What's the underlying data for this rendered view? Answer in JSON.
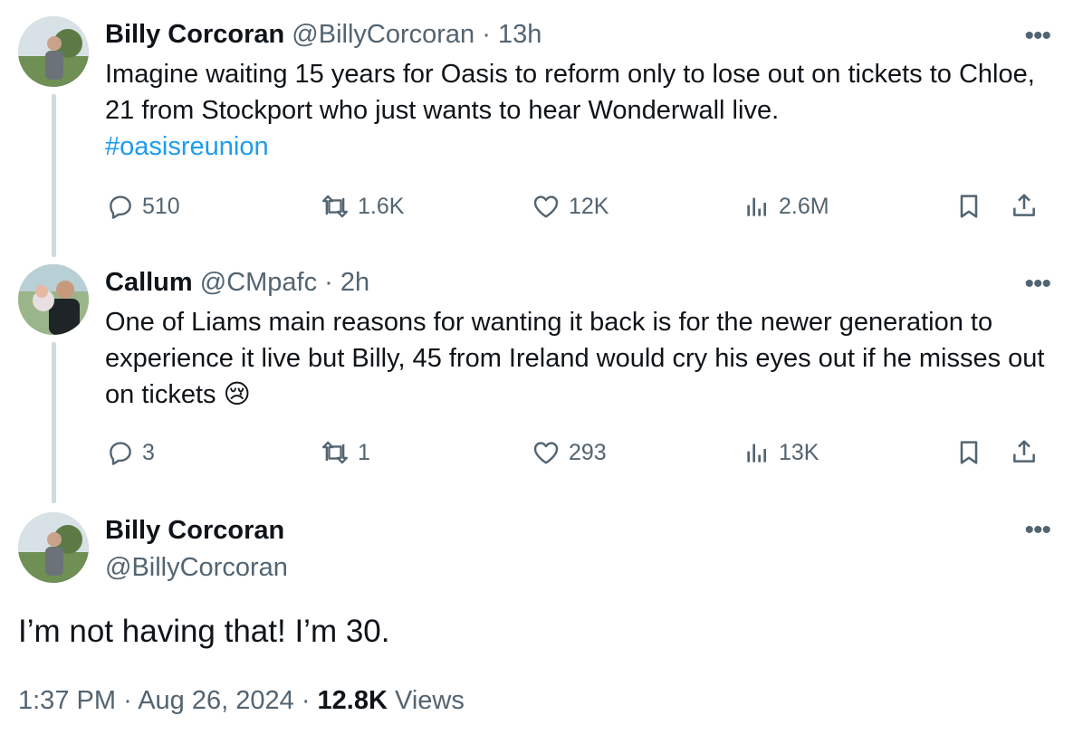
{
  "tweets": [
    {
      "name": "Billy Corcoran",
      "handle": "@BillyCorcoran",
      "time": "13h",
      "text": "Imagine waiting 15 years for Oasis to reform only to lose out on tickets to Chloe, 21 from Stockport who just wants to hear Wonderwall live.",
      "hashtag": "#oasisreunion",
      "replies": "510",
      "retweets": "1.6K",
      "likes": "12K",
      "views": "2.6M"
    },
    {
      "name": "Callum",
      "handle": "@CMpafc",
      "time": "2h",
      "text": "One of Liams main reasons for wanting it back is for the newer generation to experience it live but Billy, 45 from Ireland would cry his eyes out if he misses out on tickets",
      "emoji": "😢",
      "replies": "3",
      "retweets": "1",
      "likes": "293",
      "views": "13K"
    }
  ],
  "focus": {
    "name": "Billy Corcoran",
    "handle": "@BillyCorcoran",
    "text": "I’m not having that! I’m 30.",
    "time": "1:37 PM",
    "date": "Aug 26, 2024",
    "views_count": "12.8K",
    "views_label": "Views"
  },
  "separator": "·",
  "more_label": "•••",
  "colors": {
    "accent": "#1d9bf0",
    "muted": "#536471",
    "text": "#0f1419",
    "thread_line": "#cfd9de"
  },
  "icons": [
    "reply-icon",
    "retweet-icon",
    "like-icon",
    "views-icon",
    "bookmark-icon",
    "share-icon",
    "more-icon"
  ]
}
